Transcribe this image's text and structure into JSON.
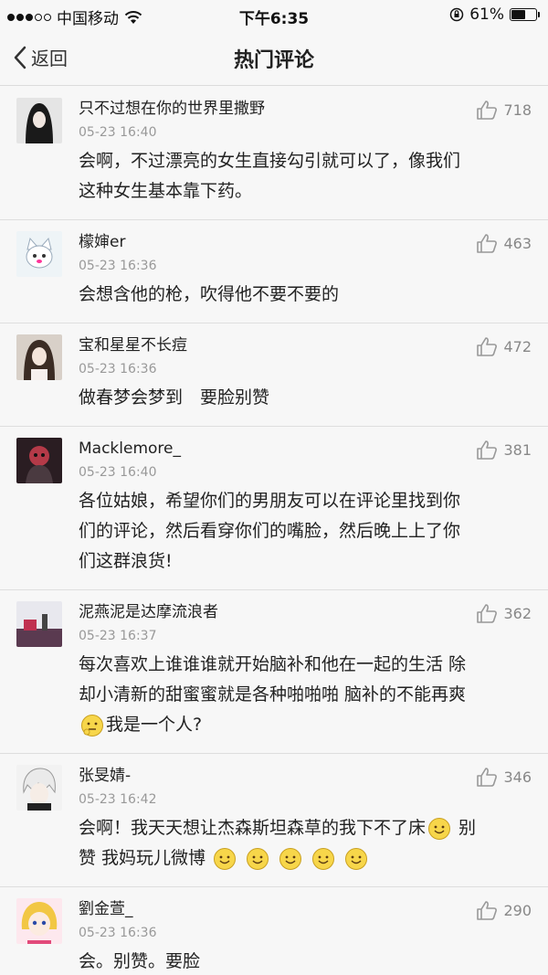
{
  "status_bar": {
    "carrier": "中国移动",
    "time": "下午6:35",
    "battery": "61%",
    "battery_level": 0.61
  },
  "nav": {
    "back_label": "返回",
    "title": "热门评论"
  },
  "comments": [
    {
      "user": "只不过想在你的世界里撒野",
      "time": "05-23 16:40",
      "likes": "718",
      "body": [
        "会啊，不过漂亮的女生直接勾引就可以了，像我们",
        "这种女生基本靠下药。"
      ]
    },
    {
      "user": "檬婶er",
      "time": "05-23 16:36",
      "likes": "463",
      "body": [
        "会想含他的枪，吹得他不要不要的"
      ]
    },
    {
      "user": "宝和星星不长痘",
      "time": "05-23 16:36",
      "likes": "472",
      "body": [
        "做春梦会梦到　要脸别赞"
      ]
    },
    {
      "user": "Macklemore_",
      "time": "05-23 16:40",
      "likes": "381",
      "body": [
        "各位姑娘，希望你们的男朋友可以在评论里找到你",
        "们的评论，然后看穿你们的嘴脸，然后晚上上了你",
        "们这群浪货!"
      ]
    },
    {
      "user": "泥燕泥是达摩流浪者",
      "time": "05-23 16:37",
      "likes": "362",
      "body": [
        "每次喜欢上谁谁谁就开始脑补和他在一起的生活 除",
        "却小清新的甜蜜蜜就是各种啪啪啪  脑补的不能再爽",
        "我是一个人?"
      ]
    },
    {
      "user": "张旻婧-",
      "time": "05-23 16:42",
      "likes": "346",
      "body": [
        "会啊！我天天想让杰森斯坦森草的我下不了床",
        " 别",
        "赞 我妈玩儿微博"
      ]
    },
    {
      "user": "劉金萱_",
      "time": "05-23 16:36",
      "likes": "290",
      "body": [
        "会。别赞。要脸"
      ]
    }
  ]
}
